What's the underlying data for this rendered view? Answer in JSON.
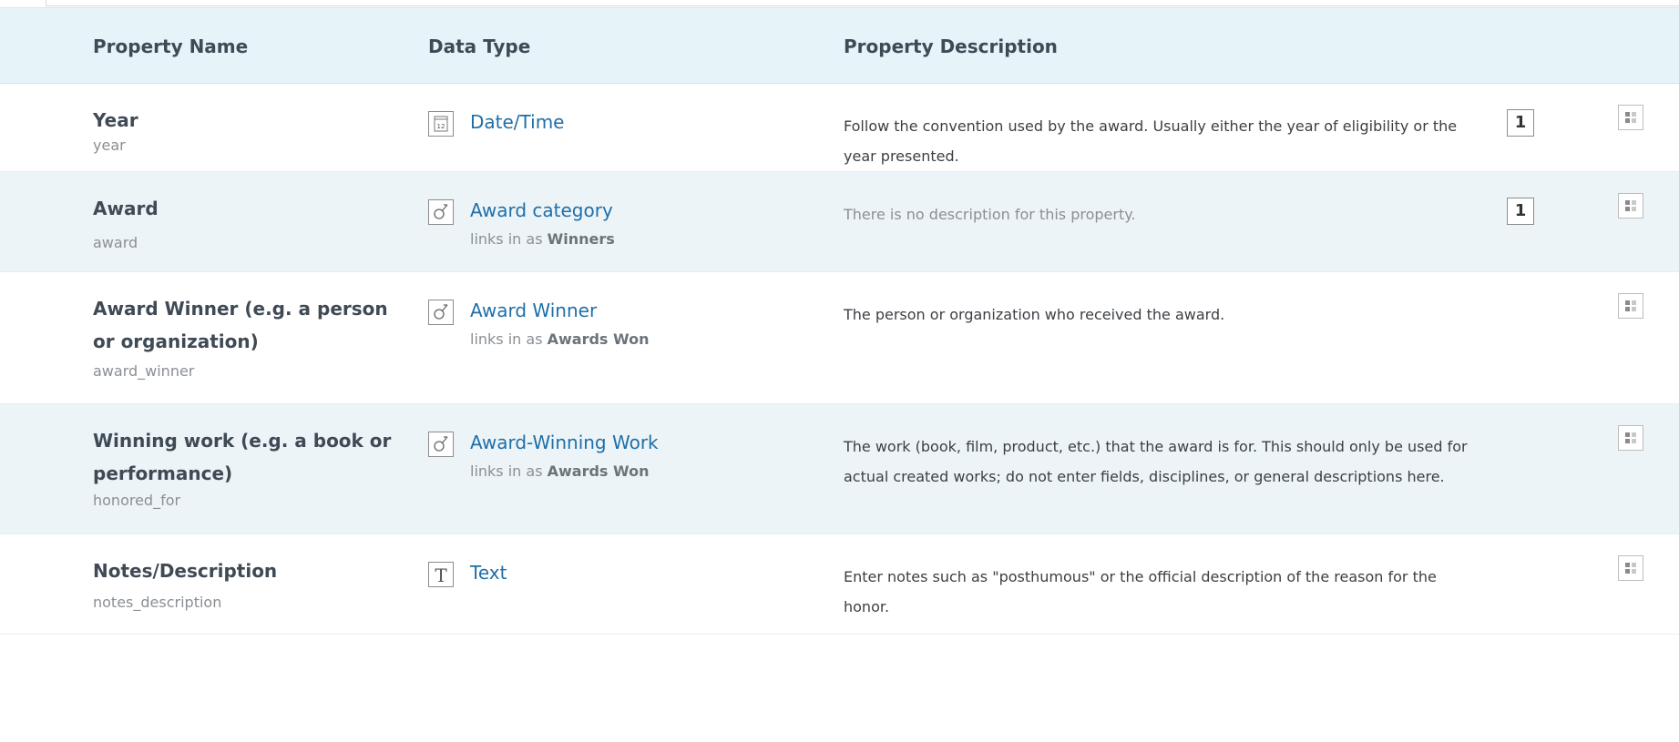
{
  "header": {
    "property_name": "Property Name",
    "data_type": "Data Type",
    "property_description": "Property Description"
  },
  "rows": [
    {
      "name": "Year",
      "key": "year",
      "type_icon": "calendar-icon",
      "type_icon_text": "12",
      "type": "Date/Time",
      "links_in_prefix": "",
      "links_in_name": "",
      "description": "Follow the convention used by the award. Usually either the year of eligibility or the year presented.",
      "count": "1"
    },
    {
      "name": "Award",
      "key": "award",
      "type_icon": "link-icon",
      "type": "Award category",
      "links_in_prefix": "links in as",
      "links_in_name": "Winners",
      "description": "There is no description for this property.",
      "count": "1"
    },
    {
      "name": "Award Winner (e.g. a person or organization)",
      "key": "award_winner",
      "type_icon": "link-icon",
      "type": "Award Winner",
      "links_in_prefix": "links in as",
      "links_in_name": "Awards Won",
      "description": "The person or organization who received the award.",
      "count": ""
    },
    {
      "name": "Winning work (e.g. a book or performance)",
      "key": "honored_for",
      "type_icon": "link-icon",
      "type": "Award-Winning Work",
      "links_in_prefix": "links in as",
      "links_in_name": "Awards Won",
      "description": "The work (book, film, product, etc.) that the award is for. This should only be used for actual created works; do not enter fields, disciplines, or general descriptions here.",
      "count": ""
    },
    {
      "name": "Notes/Description",
      "key": "notes_description",
      "type_icon": "text-type-icon",
      "type_icon_text": "T",
      "type": "Text",
      "links_in_prefix": "",
      "links_in_name": "",
      "description": "Enter notes such as \"posthumous\" or the official description of the reason for the honor.",
      "count": ""
    }
  ],
  "colors": {
    "header_bg": "#e6f4fa",
    "alt_row_bg": "#edf4f8",
    "link": "#1f6fa8"
  }
}
